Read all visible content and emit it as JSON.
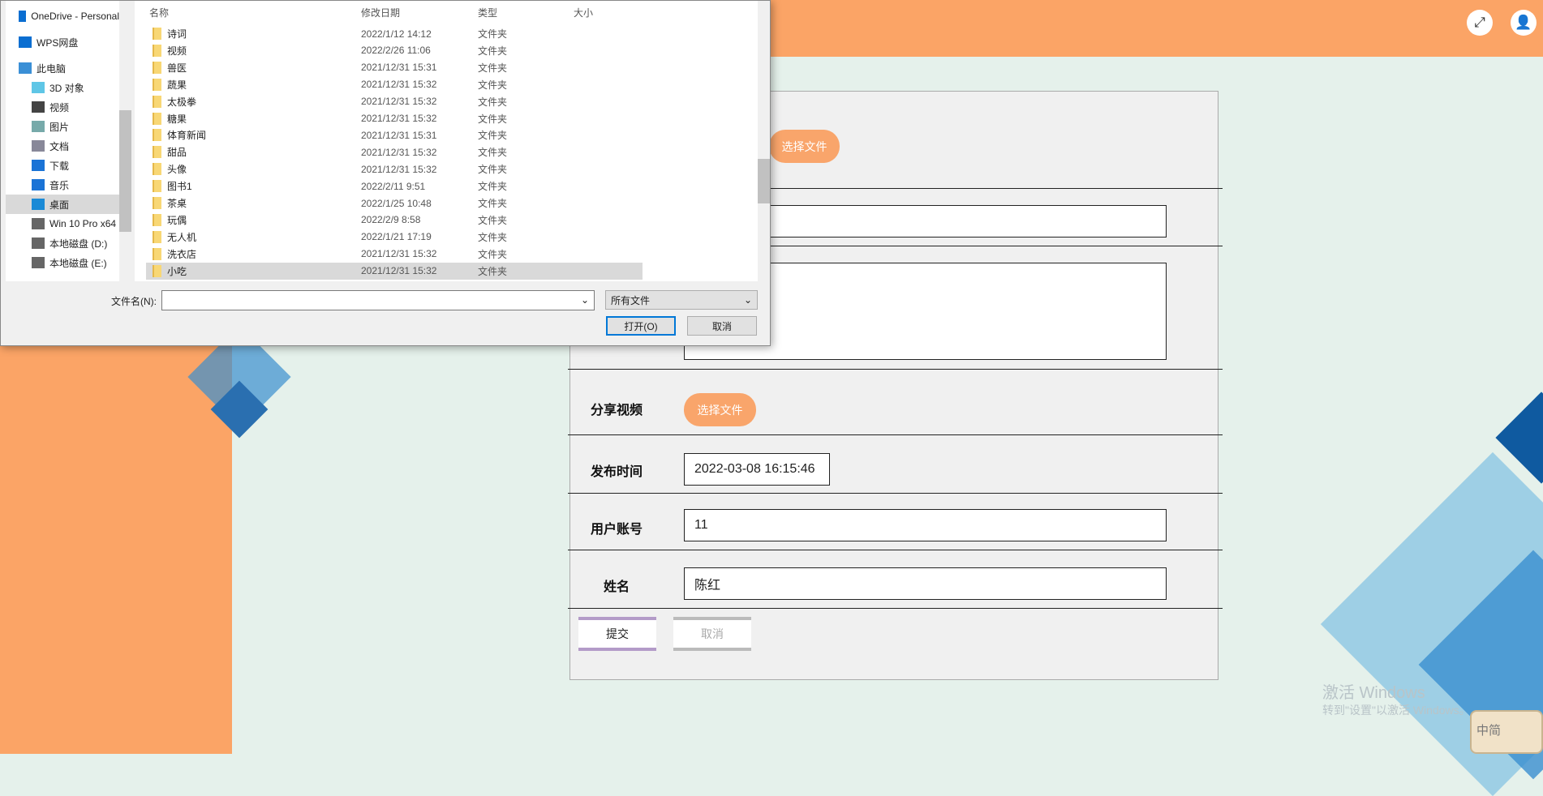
{
  "header": {
    "fullscreen_icon": "expand-icon",
    "user_icon": "user-icon"
  },
  "form": {
    "upload_button": "选择文件",
    "video_label": "分享视频",
    "video_button": "选择文件",
    "time_label": "发布时间",
    "time_value": "2022-03-08 16:15:46",
    "account_label": "用户账号",
    "account_value": "11",
    "name_label": "姓名",
    "name_value": "陈红",
    "submit": "提交",
    "cancel": "取消"
  },
  "dialog": {
    "nav": [
      {
        "label": "OneDrive - Personal",
        "icon": "cloud-icon"
      },
      {
        "label": "WPS网盘",
        "icon": "cloud-icon"
      },
      {
        "label": "此电脑",
        "icon": "computer-icon"
      },
      {
        "label": "3D 对象",
        "icon": "cube-icon"
      },
      {
        "label": "视频",
        "icon": "film-icon"
      },
      {
        "label": "图片",
        "icon": "picture-icon"
      },
      {
        "label": "文档",
        "icon": "document-icon"
      },
      {
        "label": "下载",
        "icon": "download-icon"
      },
      {
        "label": "音乐",
        "icon": "music-icon"
      },
      {
        "label": "桌面",
        "icon": "desktop-icon"
      },
      {
        "label": "Win 10 Pro x64",
        "icon": "drive-icon"
      },
      {
        "label": "本地磁盘 (D:)",
        "icon": "drive-icon"
      },
      {
        "label": "本地磁盘 (E:)",
        "icon": "drive-icon"
      }
    ],
    "columns": [
      "名称",
      "修改日期",
      "类型",
      "大小"
    ],
    "files": [
      {
        "name": "诗词",
        "date": "2022/1/12 14:12",
        "type": "文件夹"
      },
      {
        "name": "视频",
        "date": "2022/2/26 11:06",
        "type": "文件夹"
      },
      {
        "name": "兽医",
        "date": "2021/12/31 15:31",
        "type": "文件夹"
      },
      {
        "name": "蔬果",
        "date": "2021/12/31 15:32",
        "type": "文件夹"
      },
      {
        "name": "太极拳",
        "date": "2021/12/31 15:32",
        "type": "文件夹"
      },
      {
        "name": "糖果",
        "date": "2021/12/31 15:32",
        "type": "文件夹"
      },
      {
        "name": "体育新闻",
        "date": "2021/12/31 15:31",
        "type": "文件夹"
      },
      {
        "name": "甜品",
        "date": "2021/12/31 15:32",
        "type": "文件夹"
      },
      {
        "name": "头像",
        "date": "2021/12/31 15:32",
        "type": "文件夹"
      },
      {
        "name": "图书1",
        "date": "2022/2/11 9:51",
        "type": "文件夹"
      },
      {
        "name": "茶桌",
        "date": "2022/1/25 10:48",
        "type": "文件夹"
      },
      {
        "name": "玩偶",
        "date": "2022/2/9 8:58",
        "type": "文件夹"
      },
      {
        "name": "无人机",
        "date": "2022/1/21 17:19",
        "type": "文件夹"
      },
      {
        "name": "洗衣店",
        "date": "2021/12/31 15:32",
        "type": "文件夹"
      },
      {
        "name": "小吃",
        "date": "2021/12/31 15:32",
        "type": "文件夹"
      }
    ],
    "filename_label": "文件名(N):",
    "filename_value": "",
    "filter": "所有文件",
    "open": "打开(O)",
    "cancel": "取消"
  },
  "watermark": {
    "title": "激活 Windows",
    "subtitle": "转到\"设置\"以激活 Windows。"
  },
  "ime": "中简"
}
